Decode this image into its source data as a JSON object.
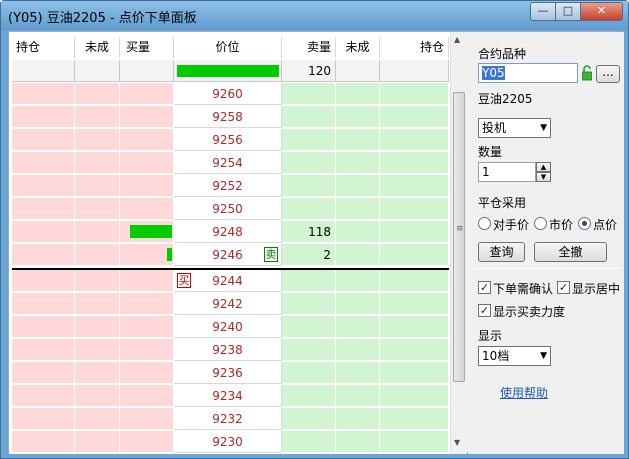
{
  "window": {
    "title": "(Y05) 豆油2205 - 点价下单面板",
    "min_glyph": "—",
    "max_glyph": "□",
    "close_glyph": "✕"
  },
  "grid": {
    "headers": {
      "buy_pos": "持仓",
      "buy_pending": "未成",
      "buy_qty": "买量",
      "price": "价位",
      "sell_qty": "卖量",
      "sell_pending": "未成",
      "sell_pos": "持仓"
    },
    "summary_sell_qty": "120",
    "summary_bar_fraction": 1.0,
    "ask_prices": [
      "9260",
      "9258",
      "9256",
      "9254",
      "9252",
      "9250",
      "9248",
      "9246"
    ],
    "ask_sell_qty": [
      "",
      "",
      "",
      "",
      "",
      "",
      "118",
      "2"
    ],
    "ask_buy_bar_fraction": [
      0,
      0,
      0,
      0,
      0,
      0,
      0.83,
      0.1
    ],
    "bid_prices": [
      "9244",
      "9242",
      "9240",
      "9238",
      "9236",
      "9234",
      "9232",
      "9230"
    ],
    "sell_tag": "卖",
    "buy_tag": "买"
  },
  "panel": {
    "contract_label": "合约品种",
    "contract_value": "Y05",
    "more_button": "...",
    "contract_name": "豆油2205",
    "order_type": "投机",
    "qty_label": "数量",
    "qty_value": "1",
    "close_label": "平仓采用",
    "radio_opponent": "对手价",
    "radio_market": "市价",
    "radio_point": "点价",
    "query_button": "查询",
    "cancel_all_button": "全撤",
    "confirm_check": "下单需确认",
    "center_check": "显示居中",
    "strength_check": "显示买卖力度",
    "display_label": "显示",
    "display_value": "10档",
    "help_link": "使用帮助"
  },
  "colors": {
    "buy_bg": "#ffd9d9",
    "sell_bg": "#d1f4d1",
    "price_text": "#b22626",
    "bar": "#00cc00"
  }
}
